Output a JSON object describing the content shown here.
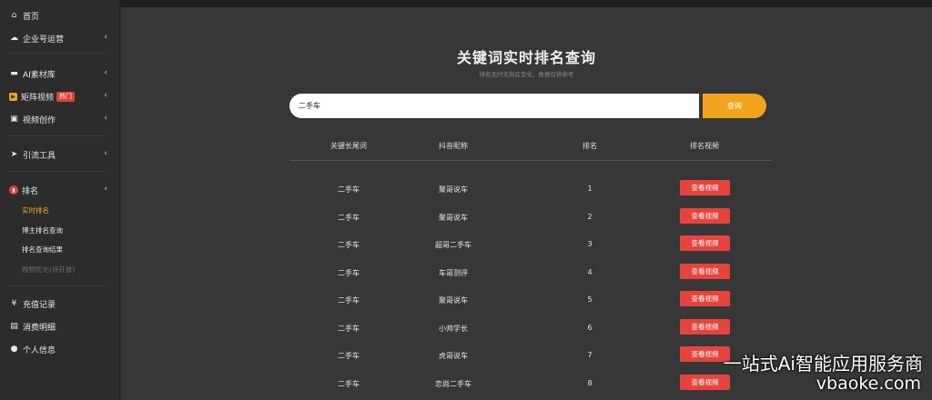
{
  "sidebar": {
    "home": "首页",
    "enterprise": "企业号运营",
    "ai_library": "AI素材库",
    "matrix_video": "矩阵视频",
    "hot_badge": "热门",
    "video_creation": "视频创作",
    "traffic_tools": "引流工具",
    "ranking": "排名",
    "sub_realtime": "实时排名",
    "sub_blogger": "博主排名查询",
    "sub_results": "排名查询结果",
    "sub_optimize": "视频优化(待开放)",
    "recharge": "充值记录",
    "consumption": "消费明细",
    "profile": "个人信息"
  },
  "main": {
    "title": "关键词实时排名查询",
    "subtitle": "排名无时无刻在变化，数据仅供参考",
    "search_value": "二手车",
    "search_button": "查询",
    "headers": [
      "关键长尾词",
      "抖音昵称",
      "排名",
      "排名视频"
    ],
    "view_label": "查看视频",
    "rows": [
      {
        "keyword": "二手车",
        "nickname": "聚哥说车",
        "rank": "1"
      },
      {
        "keyword": "二手车",
        "nickname": "聚哥说车",
        "rank": "2"
      },
      {
        "keyword": "二手车",
        "nickname": "超哥二手车",
        "rank": "3"
      },
      {
        "keyword": "二手车",
        "nickname": "车哥测评",
        "rank": "4"
      },
      {
        "keyword": "二手车",
        "nickname": "聚哥说车",
        "rank": "5"
      },
      {
        "keyword": "二手车",
        "nickname": "小帅学长",
        "rank": "6"
      },
      {
        "keyword": "二手车",
        "nickname": "虎哥说车",
        "rank": "7"
      },
      {
        "keyword": "二手车",
        "nickname": "恋尚二手车",
        "rank": "8"
      }
    ]
  },
  "watermark": {
    "line1": "一站式Ai智能应用服务商",
    "line2": "vbaoke.com"
  }
}
